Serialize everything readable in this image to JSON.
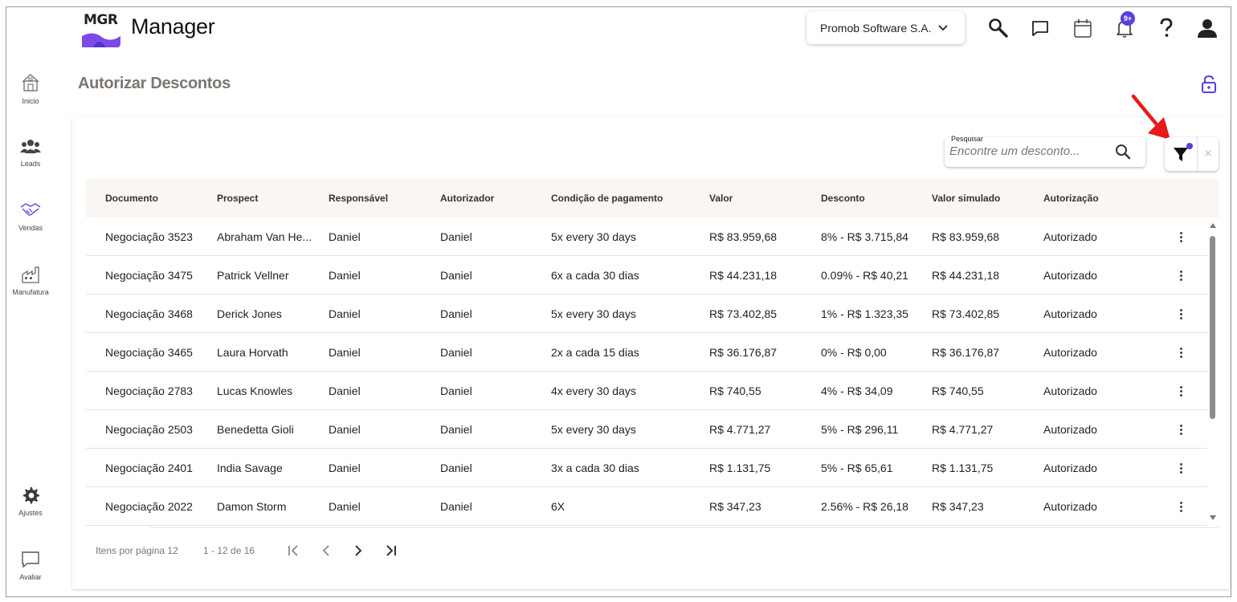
{
  "app": {
    "logo_text": "MGR",
    "title": "Manager",
    "company": "Promob Software S.A.",
    "notification_badge": "9+",
    "brand_color": "#7b4ae8"
  },
  "sidebar": {
    "items": [
      {
        "label": "Inicio",
        "icon": "home-icon"
      },
      {
        "label": "Leads",
        "icon": "people-icon"
      },
      {
        "label": "Vendas",
        "icon": "handshake-icon"
      },
      {
        "label": "Manufatura",
        "icon": "factory-icon"
      },
      {
        "label": "Ajustes",
        "icon": "gear-icon"
      },
      {
        "label": "Avaliar",
        "icon": "chat-icon"
      }
    ]
  },
  "page": {
    "title": "Autorizar Descontos"
  },
  "search": {
    "label": "Pesquisar",
    "placeholder": "Encontre um desconto..."
  },
  "filter": {
    "clear": "×"
  },
  "table": {
    "columns": [
      "Documento",
      "Prospect",
      "Responsável",
      "Autorizador",
      "Condição de pagamento",
      "Valor",
      "Desconto",
      "Valor simulado",
      "Autorização"
    ],
    "rows": [
      [
        "Negociação 3523",
        "Abraham Van He...",
        "Daniel",
        "Daniel",
        "5x every 30 days",
        "R$ 83.959,68",
        "8% - R$ 3.715,84",
        "R$ 83.959,68",
        "Autorizado"
      ],
      [
        "Negociação 3475",
        "Patrick Vellner",
        "Daniel",
        "Daniel",
        "6x a cada 30 dias",
        "R$ 44.231,18",
        "0.09% - R$ 40,21",
        "R$ 44.231,18",
        "Autorizado"
      ],
      [
        "Negociação 3468",
        "Derick Jones",
        "Daniel",
        "Daniel",
        "5x every 30 days",
        "R$ 73.402,85",
        "1% - R$ 1.323,35",
        "R$ 73.402,85",
        "Autorizado"
      ],
      [
        "Negociação 3465",
        "Laura Horvath",
        "Daniel",
        "Daniel",
        "2x a cada 15 dias",
        "R$ 36.176,87",
        "0% - R$ 0,00",
        "R$ 36.176,87",
        "Autorizado"
      ],
      [
        "Negociação 2783",
        "Lucas Knowles",
        "Daniel",
        "Daniel",
        "4x every 30 days",
        "R$ 740,55",
        "4% - R$ 34,09",
        "R$ 740,55",
        "Autorizado"
      ],
      [
        "Negociação 2503",
        "Benedetta Gioli",
        "Daniel",
        "Daniel",
        "5x every 30 days",
        "R$ 4.771,27",
        "5% - R$ 296,11",
        "R$ 4.771,27",
        "Autorizado"
      ],
      [
        "Negociação 2401",
        "India Savage",
        "Daniel",
        "Daniel",
        "3x a cada 30 dias",
        "R$ 1.131,75",
        "5% - R$ 65,61",
        "R$ 1.131,75",
        "Autorizado"
      ],
      [
        "Negociação 2022",
        "Damon Storm",
        "Daniel",
        "Daniel",
        "6X",
        "R$ 347,23",
        "2.56% - R$ 26,18",
        "R$ 347,23",
        "Autorizado"
      ]
    ]
  },
  "pagination": {
    "items_per_page_label": "Itens por página 12",
    "range": "1 - 12 de 16"
  }
}
